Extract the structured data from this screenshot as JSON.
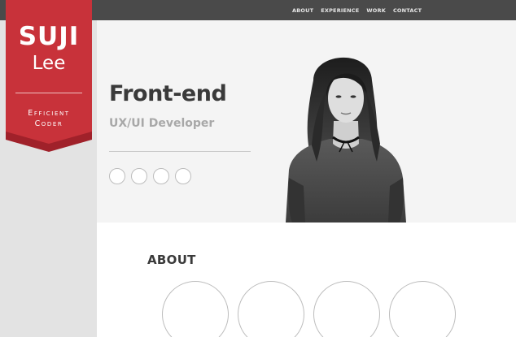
{
  "nav": {
    "items": [
      "ABOUT",
      "EXPERIENCE",
      "WORK",
      "CONTACT"
    ]
  },
  "logo": {
    "first_name": "SUJI",
    "last_name": "Lee",
    "tagline_line1": "Efficient",
    "tagline_line2": "Coder",
    "color": "#c8323a"
  },
  "hero": {
    "headline": "Front-end",
    "subheadline": "UX/UI Developer",
    "social_icons": [
      "social-icon",
      "social-icon",
      "social-icon",
      "social-icon"
    ]
  },
  "about": {
    "title": "ABOUT",
    "cards": [
      "circle-card",
      "circle-card",
      "circle-card",
      "circle-card"
    ]
  },
  "colors": {
    "topbar": "#4a4a4a",
    "ribbon": "#c8323a",
    "ribbon_dark": "#a0212a",
    "sidebar": "#e3e3e3",
    "hero_bg": "#f4f4f4"
  }
}
